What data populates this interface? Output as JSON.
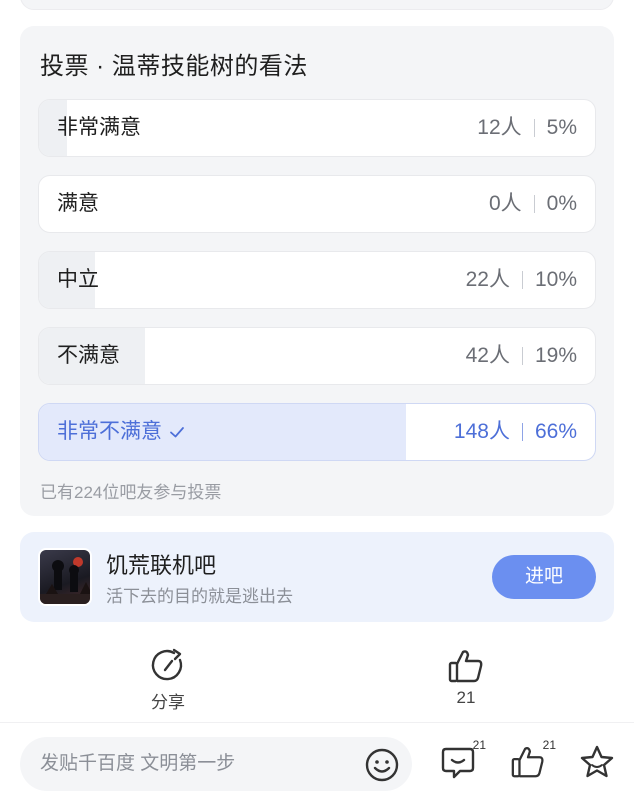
{
  "poll": {
    "title": "投票 · 温蒂技能树的看法",
    "options": [
      {
        "label": "非常满意",
        "count": "12人",
        "percent": "5%",
        "fraction": 0.05,
        "selected": false
      },
      {
        "label": "满意",
        "count": "0人",
        "percent": "0%",
        "fraction": 0.0,
        "selected": false
      },
      {
        "label": "中立",
        "count": "22人",
        "percent": "10%",
        "fraction": 0.1,
        "selected": false
      },
      {
        "label": "不满意",
        "count": "42人",
        "percent": "19%",
        "fraction": 0.19,
        "selected": false
      },
      {
        "label": "非常不满意",
        "count": "148人",
        "percent": "66%",
        "fraction": 0.66,
        "selected": true
      }
    ],
    "participants": "已有224位吧友参与投票"
  },
  "forum": {
    "name": "饥荒联机吧",
    "description": "活下去的目的就是逃出去",
    "join_label": "进吧"
  },
  "actions": {
    "share_label": "分享",
    "like_count": "21"
  },
  "bottom_bar": {
    "comment_placeholder": "发贴千百度 文明第一步",
    "comment_badge": "21",
    "like_badge": "21"
  },
  "colors": {
    "accent": "#4d6fd8",
    "join_button": "#6b8ff0",
    "card_bg": "#f4f5f7",
    "forum_bg": "#edf2fc"
  }
}
